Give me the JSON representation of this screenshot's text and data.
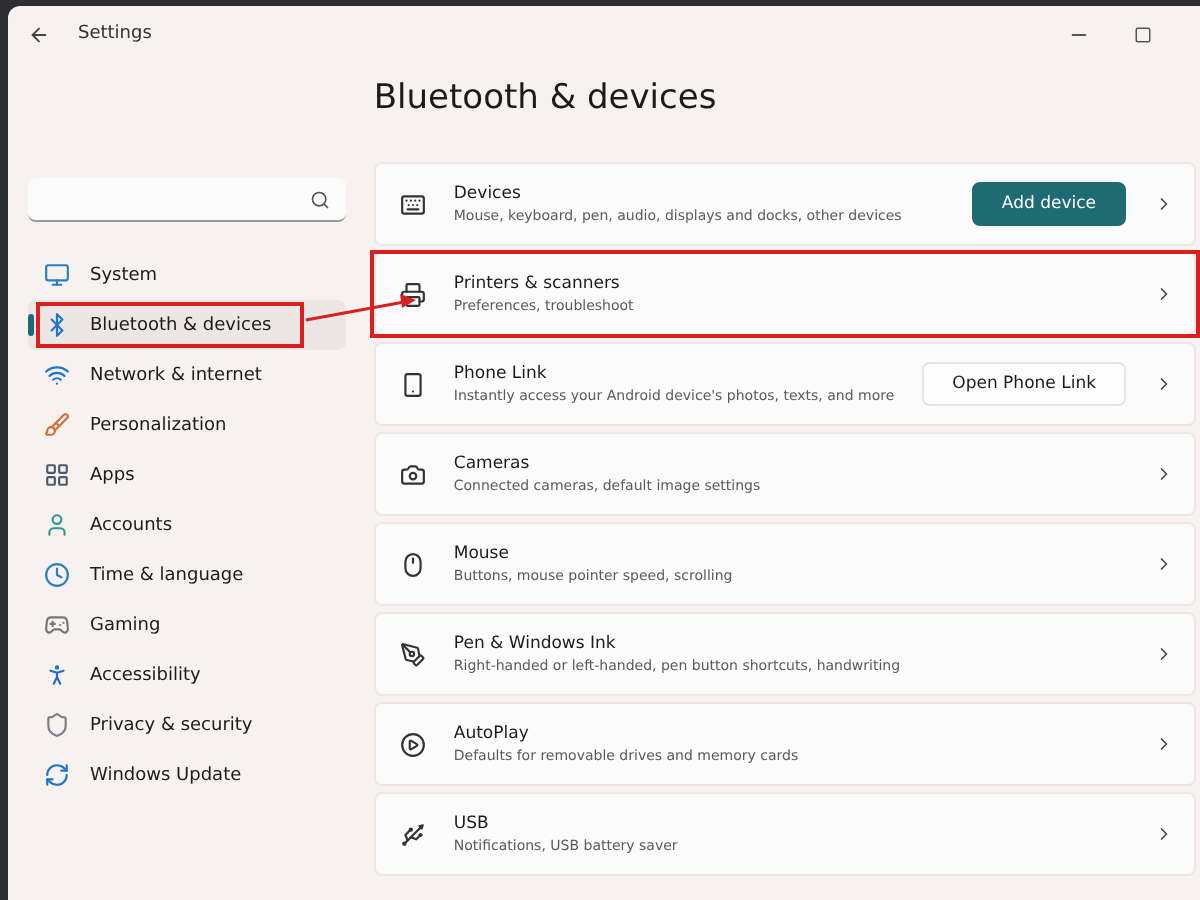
{
  "window": {
    "title": "Settings"
  },
  "sidebar": {
    "items": [
      {
        "label": "System",
        "selected": false
      },
      {
        "label": "Bluetooth & devices",
        "selected": true,
        "highlighted": true
      },
      {
        "label": "Network & internet",
        "selected": false
      },
      {
        "label": "Personalization",
        "selected": false
      },
      {
        "label": "Apps",
        "selected": false
      },
      {
        "label": "Accounts",
        "selected": false
      },
      {
        "label": "Time & language",
        "selected": false
      },
      {
        "label": "Gaming",
        "selected": false
      },
      {
        "label": "Accessibility",
        "selected": false
      },
      {
        "label": "Privacy & security",
        "selected": false
      },
      {
        "label": "Windows Update",
        "selected": false
      }
    ]
  },
  "page": {
    "title": "Bluetooth & devices",
    "cards": [
      {
        "title": "Devices",
        "subtitle": "Mouse, keyboard, pen, audio, displays and docks, other devices",
        "action": {
          "kind": "primary",
          "label": "Add device"
        },
        "highlighted": false
      },
      {
        "title": "Printers & scanners",
        "subtitle": "Preferences, troubleshoot",
        "highlighted": true
      },
      {
        "title": "Phone Link",
        "subtitle": "Instantly access your Android device's photos, texts, and more",
        "action": {
          "kind": "secondary",
          "label": "Open Phone Link"
        },
        "highlighted": false
      },
      {
        "title": "Cameras",
        "subtitle": "Connected cameras, default image settings",
        "highlighted": false
      },
      {
        "title": "Mouse",
        "subtitle": "Buttons, mouse pointer speed, scrolling",
        "highlighted": false
      },
      {
        "title": "Pen & Windows Ink",
        "subtitle": "Right-handed or left-handed, pen button shortcuts, handwriting",
        "highlighted": false
      },
      {
        "title": "AutoPlay",
        "subtitle": "Defaults for removable drives and memory cards",
        "highlighted": false
      },
      {
        "title": "USB",
        "subtitle": "Notifications, USB battery saver",
        "highlighted": false
      }
    ]
  }
}
